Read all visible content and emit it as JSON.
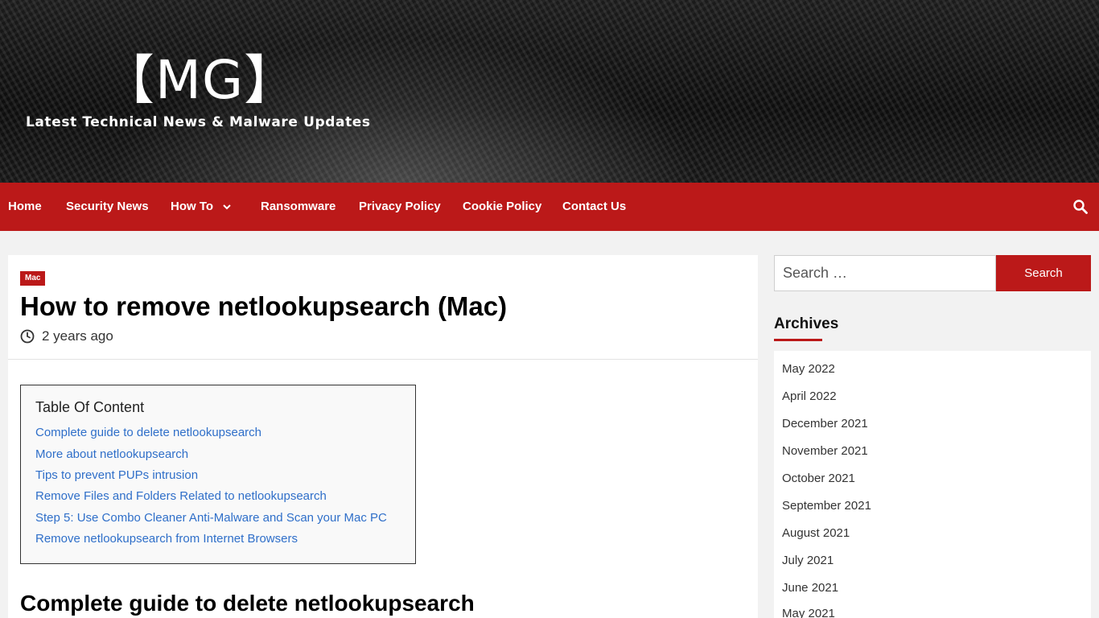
{
  "site": {
    "logo": "【MG】",
    "tagline": "Latest Technical News & Malware Updates"
  },
  "nav": {
    "items": [
      "Home",
      "Security News",
      "How To",
      "Ransomware",
      "Privacy Policy",
      "Cookie Policy",
      "Contact Us"
    ]
  },
  "article": {
    "category": "Mac",
    "title": "How to remove netlookupsearch (Mac)",
    "date": "2 years ago",
    "toc": {
      "title": "Table Of Content",
      "links": [
        "Complete guide to delete netlookupsearch",
        "More about netlookupsearch",
        "Tips to prevent PUPs intrusion",
        "Remove Files and Folders Related to netlookupsearch",
        "Step 5: Use Combo Cleaner Anti-Malware and Scan your Mac PC",
        "Remove netlookupsearch from Internet Browsers"
      ]
    },
    "section_heading": "Complete guide to delete netlookupsearch"
  },
  "sidebar": {
    "search_placeholder": "Search …",
    "search_button": "Search",
    "archives_title": "Archives",
    "archives": [
      "May 2022",
      "April 2022",
      "December 2021",
      "November 2021",
      "October 2021",
      "September 2021",
      "August 2021",
      "July 2021",
      "June 2021",
      "May 2021"
    ]
  },
  "colors": {
    "accent": "#bb1919",
    "link": "#2f6fc9"
  }
}
